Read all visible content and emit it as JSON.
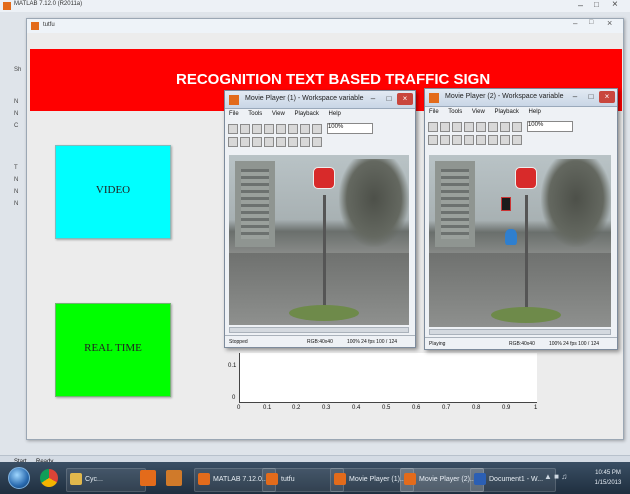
{
  "matlab": {
    "title": "MATLAB 7.12.0 (R2011a)",
    "side_letters": [
      "Sh",
      "N",
      "N",
      "C",
      "T",
      "N",
      "N",
      "N"
    ]
  },
  "figure": {
    "title": "tutfu",
    "header_text": "RECOGNITION TEXT BASED TRAFFIC SIGN"
  },
  "buttons": {
    "video": "VIDEO",
    "realtime": "REAL TIME"
  },
  "players": [
    {
      "title": "Movie Player (1) - Workspace variable",
      "menus": [
        "File",
        "Tools",
        "View",
        "Playback",
        "Help"
      ],
      "zoom": "100%",
      "status_left": "Stopped",
      "status_mid": "RGB:40x40",
      "status_right": "100% 24 fps  100 / 124"
    },
    {
      "title": "Movie Player (2) - Workspace variable",
      "menus": [
        "File",
        "Tools",
        "View",
        "Playback",
        "Help"
      ],
      "zoom": "100%",
      "status_left": "Playing",
      "status_mid": "RGB:40x40",
      "status_right": "100% 24 fps  100 / 124"
    }
  ],
  "axes": {
    "y_ticks": [
      "0.1",
      "0"
    ],
    "x_ticks": [
      "0",
      "0.1",
      "0.2",
      "0.3",
      "0.4",
      "0.5",
      "0.6",
      "0.7",
      "0.8",
      "0.9",
      "1"
    ]
  },
  "statusbar": {
    "label": "Start",
    "text": "Ready"
  },
  "taskbar": {
    "items": [
      "Cyc...",
      "MATLAB 7.12.0...",
      "tutfu",
      "Movie Player (1)...",
      "Movie Player (2)...",
      "Document1 - W..."
    ],
    "clock_time": "10:45 PM",
    "clock_date": "1/15/2013"
  },
  "colors": {
    "header": "#ff0000",
    "video_button": "#00ffff",
    "realtime_button": "#00ff00",
    "taskbar": "#1f2f3f"
  }
}
